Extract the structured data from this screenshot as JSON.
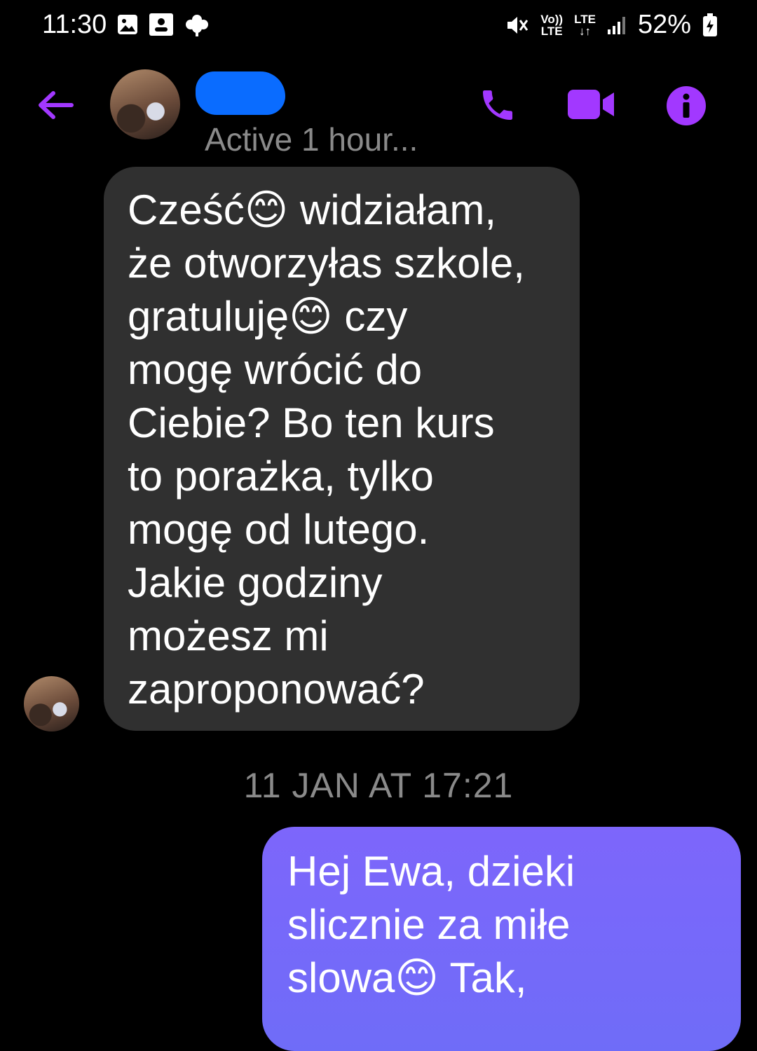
{
  "status_bar": {
    "time": "11:30",
    "net_top": "Vo))",
    "net_bottom": "LTE",
    "lte_label": "LTE",
    "battery_percent": "52%"
  },
  "header": {
    "active_status": "Active 1 hour..."
  },
  "messages": {
    "received_text": "Cześć😊 widziałam,\nże otworzyłas szkole,\ngratuluję😊 czy\nmogę wrócić do\nCiebie? Bo ten kurs\nto porażka, tylko\nmogę od lutego.\nJakie godziny\nmożesz mi\nzaproponować?",
    "timestamp": "11 JAN AT 17:21",
    "sent_text": "Hej Ewa, dzieki\nslicznie za miłe\nslowa😊 Tak,"
  },
  "colors": {
    "accent": "#a238ff",
    "received_bubble": "#303030",
    "sent_bubble": "#7d66fb",
    "muted_text": "#8a8a8a"
  }
}
